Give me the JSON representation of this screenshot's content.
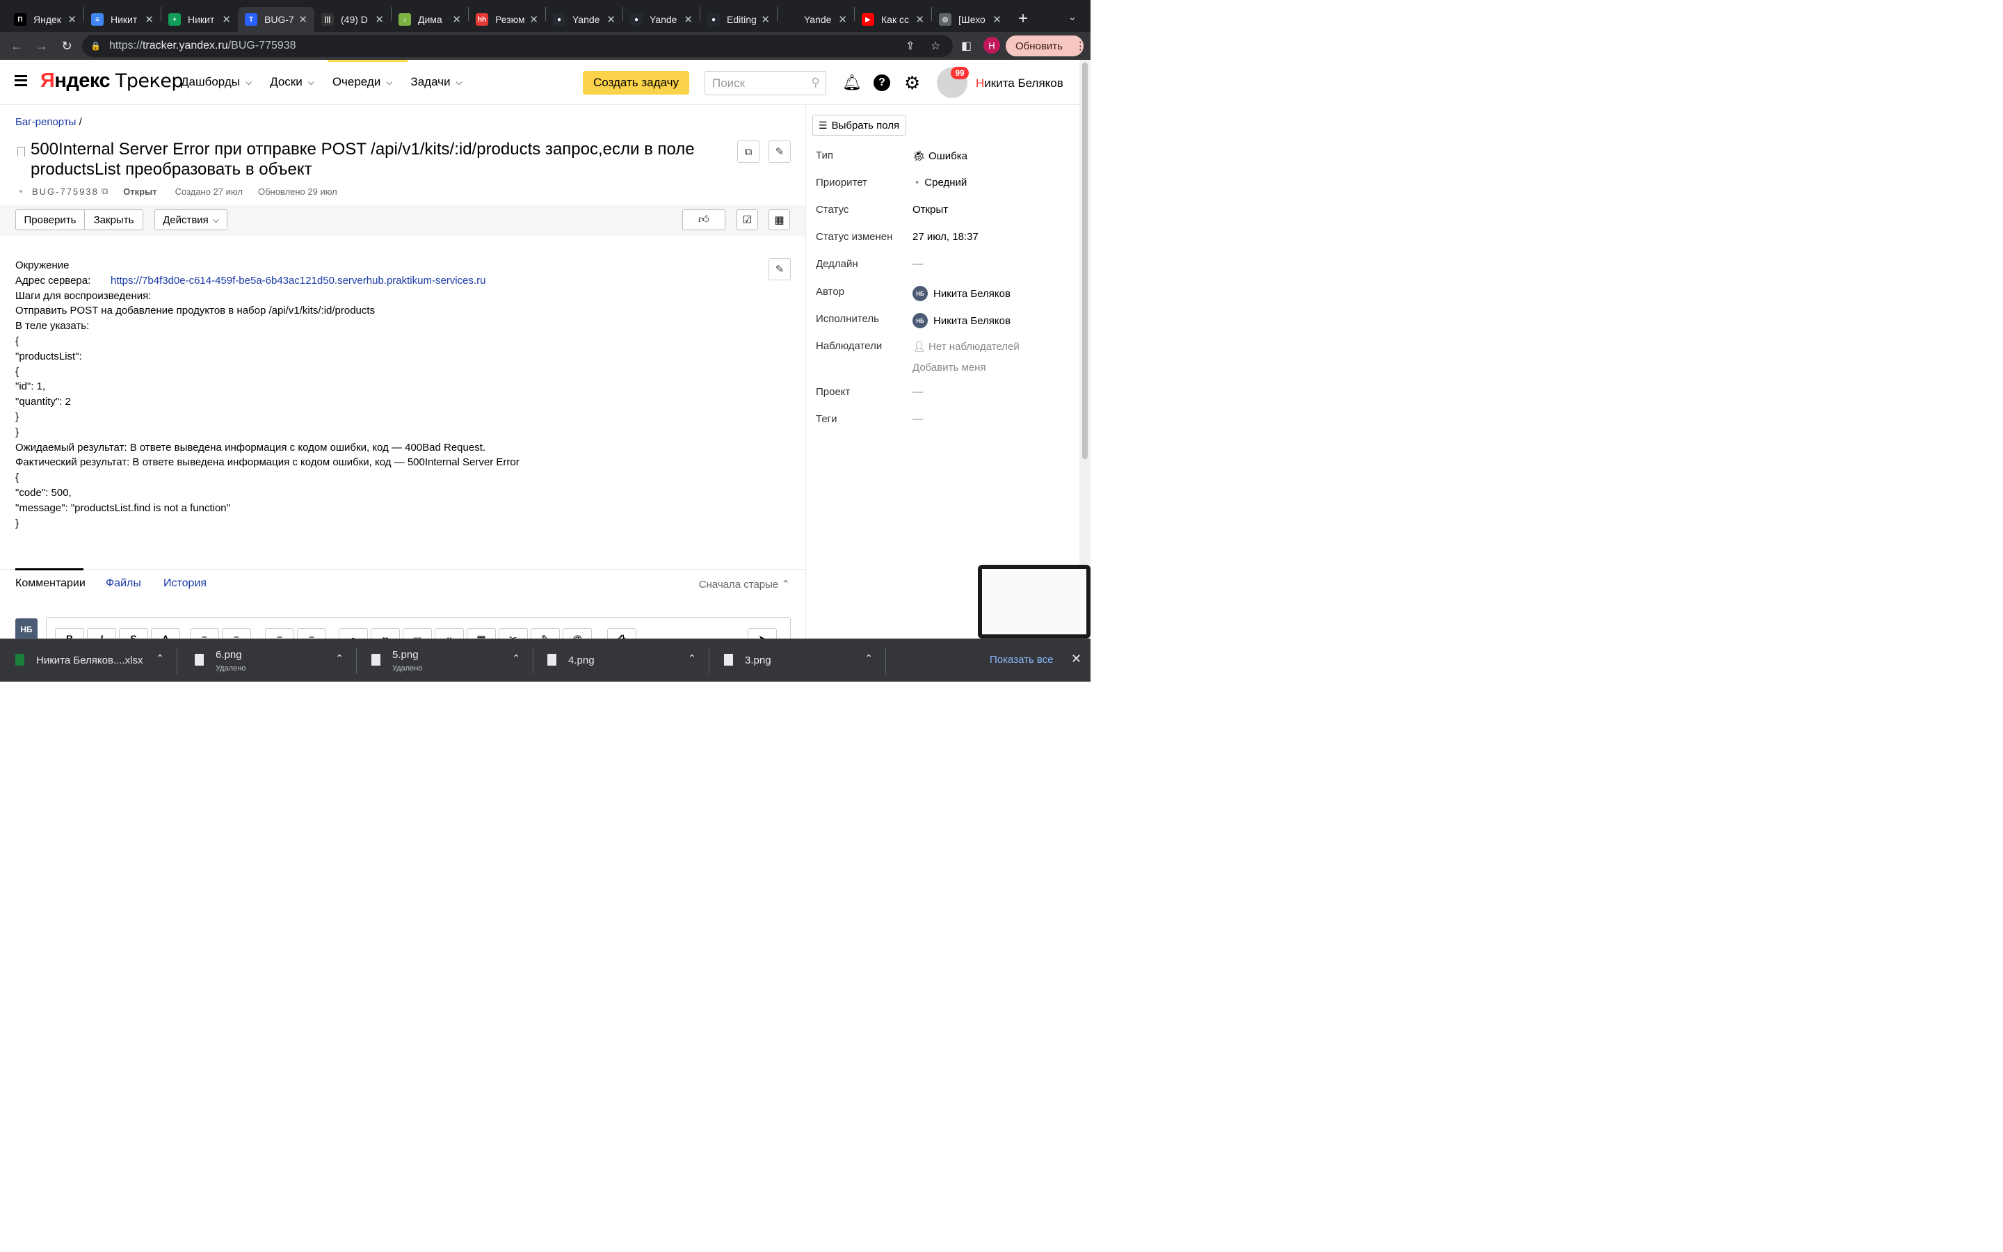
{
  "browser": {
    "tabs": [
      {
        "title": "Яндек",
        "fav_color": "#000000",
        "fav_glyph": "П"
      },
      {
        "title": "Никит",
        "fav_color": "#4285f4",
        "fav_glyph": "≡"
      },
      {
        "title": "Никит",
        "fav_color": "#0f9d58",
        "fav_glyph": "+"
      },
      {
        "title": "BUG-7",
        "fav_color": "#2962ff",
        "fav_glyph": "T",
        "active": true
      },
      {
        "title": "(49) D",
        "fav_color": "#333333",
        "fav_glyph": "|||"
      },
      {
        "title": "Дима",
        "fav_color": "#7cb342",
        "fav_glyph": "♪"
      },
      {
        "title": "Резюм",
        "fav_color": "#e53935",
        "fav_glyph": "hh"
      },
      {
        "title": "Yande",
        "fav_color": "#24292f",
        "fav_glyph": "●"
      },
      {
        "title": "Yande",
        "fav_color": "#24292f",
        "fav_glyph": "●"
      },
      {
        "title": "Editing",
        "fav_color": "#24292f",
        "fav_glyph": "●"
      },
      {
        "title": "Yande",
        "fav_color": "#202124",
        "fav_glyph": ""
      },
      {
        "title": "Как сс",
        "fav_color": "#ff0000",
        "fav_glyph": "▶"
      },
      {
        "title": "[Шехо",
        "fav_color": "#5f6368",
        "fav_glyph": "◍"
      }
    ],
    "url_prefix": "https://",
    "url_host": "tracker.yandex.ru",
    "url_path": "/BUG-775938",
    "profile_letter": "Н",
    "update_label": "Обновить"
  },
  "header": {
    "logo_ya_first": "Я",
    "logo_ya_rest": "ндекс",
    "logo_product": "Трекер",
    "nav": [
      "Дашборды",
      "Доски",
      "Очереди",
      "Задачи"
    ],
    "create_label": "Создать задачу",
    "search_placeholder": "Поиск",
    "notif_count": "99",
    "user_first_letter": "Н",
    "user_rest": "икита Беляков"
  },
  "issue": {
    "breadcrumb": "Баг-репорты",
    "breadcrumb_sep": "/",
    "title": "500Internal Server Error при отправке POST /api/v1/kits/:id/products запрос,если в поле productsList преобразовать в объект",
    "key": "BUG-775938",
    "status": "Открыт",
    "created": "Создано 27 июл",
    "updated": "Обновлено 29 июл",
    "actions": {
      "check": "Проверить",
      "close": "Закрыть",
      "more": "Действия"
    }
  },
  "description": {
    "env": "Окружение",
    "server_label": "Адрес сервера:",
    "server_url": "https://7b4f3d0e-c614-459f-be5a-6b43ac121d50.serverhub.praktikum-services.ru",
    "lines": [
      "Шаги для воспроизведения:",
      "Отправить POST на добавление продуктов в набор /api/v1/kits/:id/products",
      "В теле указать:",
      "{",
      "\"productsList\":",
      "{",
      "\"id\": 1,",
      "\"quantity\": 2",
      "}",
      "}",
      "Ожидаемый результат: В ответе выведена информация с кодом ошибки, код — 400Bad Request.",
      "Фактический результат: В ответе выведена информация с кодом ошибки, код — 500Internal Server Error",
      "{",
      "\"code\": 500,",
      "\"message\": \"productsList.find is not a function\"",
      "}"
    ]
  },
  "comments": {
    "tabs": [
      "Комментарии",
      "Файлы",
      "История"
    ],
    "sort": "Сначала старые",
    "avatar": "НБ",
    "toolbar": [
      "B",
      "I",
      "S",
      "A"
    ]
  },
  "sidebar": {
    "choose_fields": "Выбрать поля",
    "props": [
      {
        "label": "Тип",
        "value": "Ошибка"
      },
      {
        "label": "Приоритет",
        "value": "Средний"
      },
      {
        "label": "Статус",
        "value": "Открыт"
      },
      {
        "label": "Статус изменен",
        "value": "27 июл, 18:37"
      },
      {
        "label": "Дедлайн",
        "value": "—"
      },
      {
        "label": "Автор",
        "value": "Никита Беляков"
      },
      {
        "label": "Исполнитель",
        "value": "Никита Беляков"
      },
      {
        "label": "Наблюдатели",
        "value": "Нет наблюдателей"
      },
      {
        "label": "Проект",
        "value": "—"
      },
      {
        "label": "Теги",
        "value": "—"
      }
    ],
    "add_me": "Добавить меня",
    "user_initials": "НБ"
  },
  "downloads": {
    "items": [
      {
        "name": "Никита Беляков....xlsx",
        "sub": ""
      },
      {
        "name": "6.png",
        "sub": "Удалено"
      },
      {
        "name": "5.png",
        "sub": "Удалено"
      },
      {
        "name": "4.png",
        "sub": ""
      },
      {
        "name": "3.png",
        "sub": ""
      }
    ],
    "show_all": "Показать все"
  }
}
